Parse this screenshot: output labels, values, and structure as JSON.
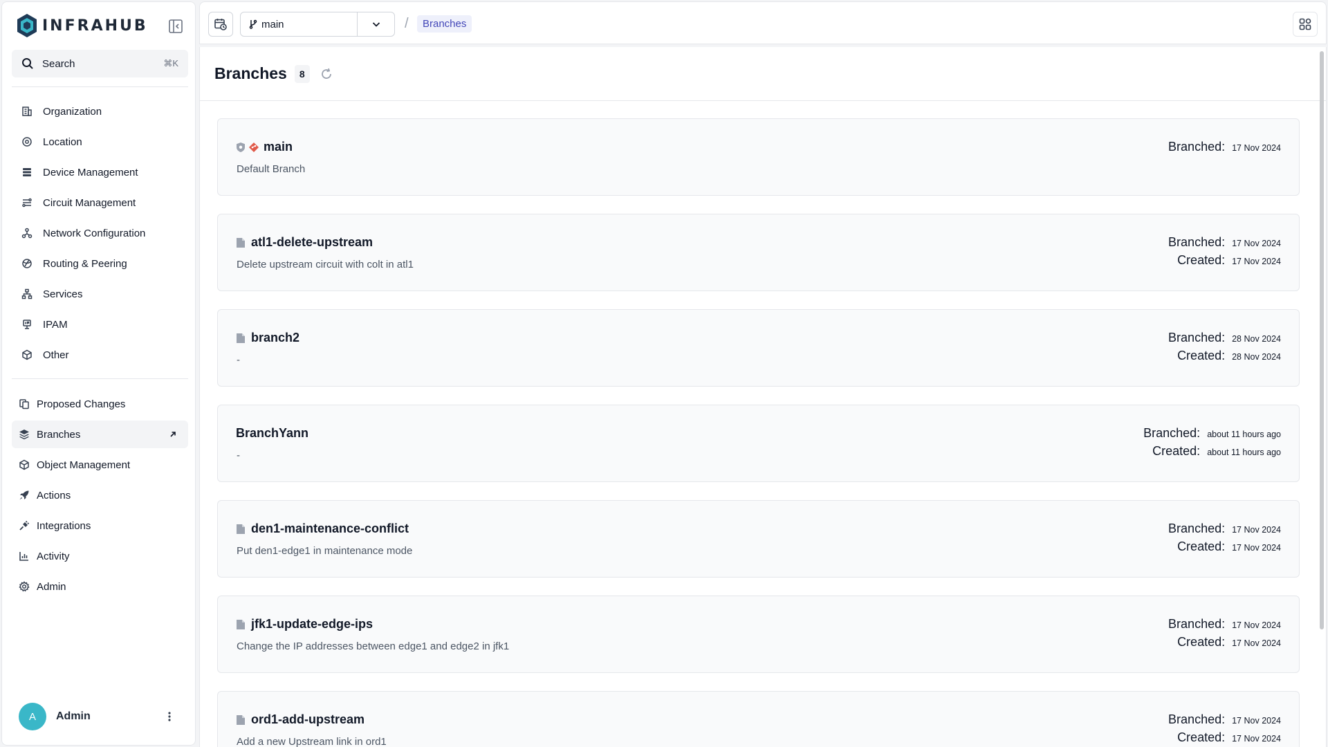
{
  "app": {
    "brand": "INFRAHUB"
  },
  "search": {
    "label": "Search",
    "shortcut": "⌘K"
  },
  "sidebar": {
    "primary": [
      {
        "label": "Organization",
        "icon": "building-icon"
      },
      {
        "label": "Location",
        "icon": "map-pin-icon"
      },
      {
        "label": "Device Management",
        "icon": "server-icon"
      },
      {
        "label": "Circuit Management",
        "icon": "circuit-icon"
      },
      {
        "label": "Network Configuration",
        "icon": "network-icon"
      },
      {
        "label": "Routing & Peering",
        "icon": "globe-icon"
      },
      {
        "label": "Services",
        "icon": "sitemap-icon"
      },
      {
        "label": "IPAM",
        "icon": "ip-icon"
      },
      {
        "label": "Other",
        "icon": "cube-icon"
      }
    ],
    "secondary": [
      {
        "label": "Proposed Changes",
        "icon": "diff-icon"
      },
      {
        "label": "Branches",
        "icon": "layers-icon"
      },
      {
        "label": "Object Management",
        "icon": "cube-icon"
      },
      {
        "label": "Actions",
        "icon": "rocket-icon"
      },
      {
        "label": "Integrations",
        "icon": "plug-icon"
      },
      {
        "label": "Activity",
        "icon": "bar-chart-icon"
      },
      {
        "label": "Admin",
        "icon": "gear-icon"
      }
    ],
    "active": "Branches"
  },
  "user": {
    "initial": "A",
    "name": "Admin"
  },
  "topbar": {
    "branch": "main",
    "separator": "/",
    "breadcrumb": "Branches"
  },
  "page": {
    "title": "Branches",
    "count": "8"
  },
  "branches": [
    {
      "name": "main",
      "description": "Default Branch",
      "branched_label": "Branched:",
      "branched": "17 Nov 2024",
      "created_label": "",
      "created": ""
    },
    {
      "name": "atl1-delete-upstream",
      "description": "Delete upstream circuit with colt in atl1",
      "branched_label": "Branched:",
      "branched": "17 Nov 2024",
      "created_label": "Created:",
      "created": "17 Nov 2024"
    },
    {
      "name": "branch2",
      "description": "-",
      "branched_label": "Branched:",
      "branched": "28 Nov 2024",
      "created_label": "Created:",
      "created": "28 Nov 2024"
    },
    {
      "name": "BranchYann",
      "description": "-",
      "branched_label": "Branched:",
      "branched": "about 11 hours ago",
      "created_label": "Created:",
      "created": "about 11 hours ago"
    },
    {
      "name": "den1-maintenance-conflict",
      "description": "Put den1-edge1 in maintenance mode",
      "branched_label": "Branched:",
      "branched": "17 Nov 2024",
      "created_label": "Created:",
      "created": "17 Nov 2024"
    },
    {
      "name": "jfk1-update-edge-ips",
      "description": "Change the IP addresses between edge1 and edge2 in jfk1",
      "branched_label": "Branched:",
      "branched": "17 Nov 2024",
      "created_label": "Created:",
      "created": "17 Nov 2024"
    },
    {
      "name": "ord1-add-upstream",
      "description": "Add a new Upstream link in ord1",
      "branched_label": "Branched:",
      "branched": "17 Nov 2024",
      "created_label": "Created:",
      "created": "17 Nov 2024"
    }
  ],
  "colors": {
    "accent": "#4347b8",
    "avatar": "#3ab7c8",
    "brand": "#1f3b57"
  }
}
